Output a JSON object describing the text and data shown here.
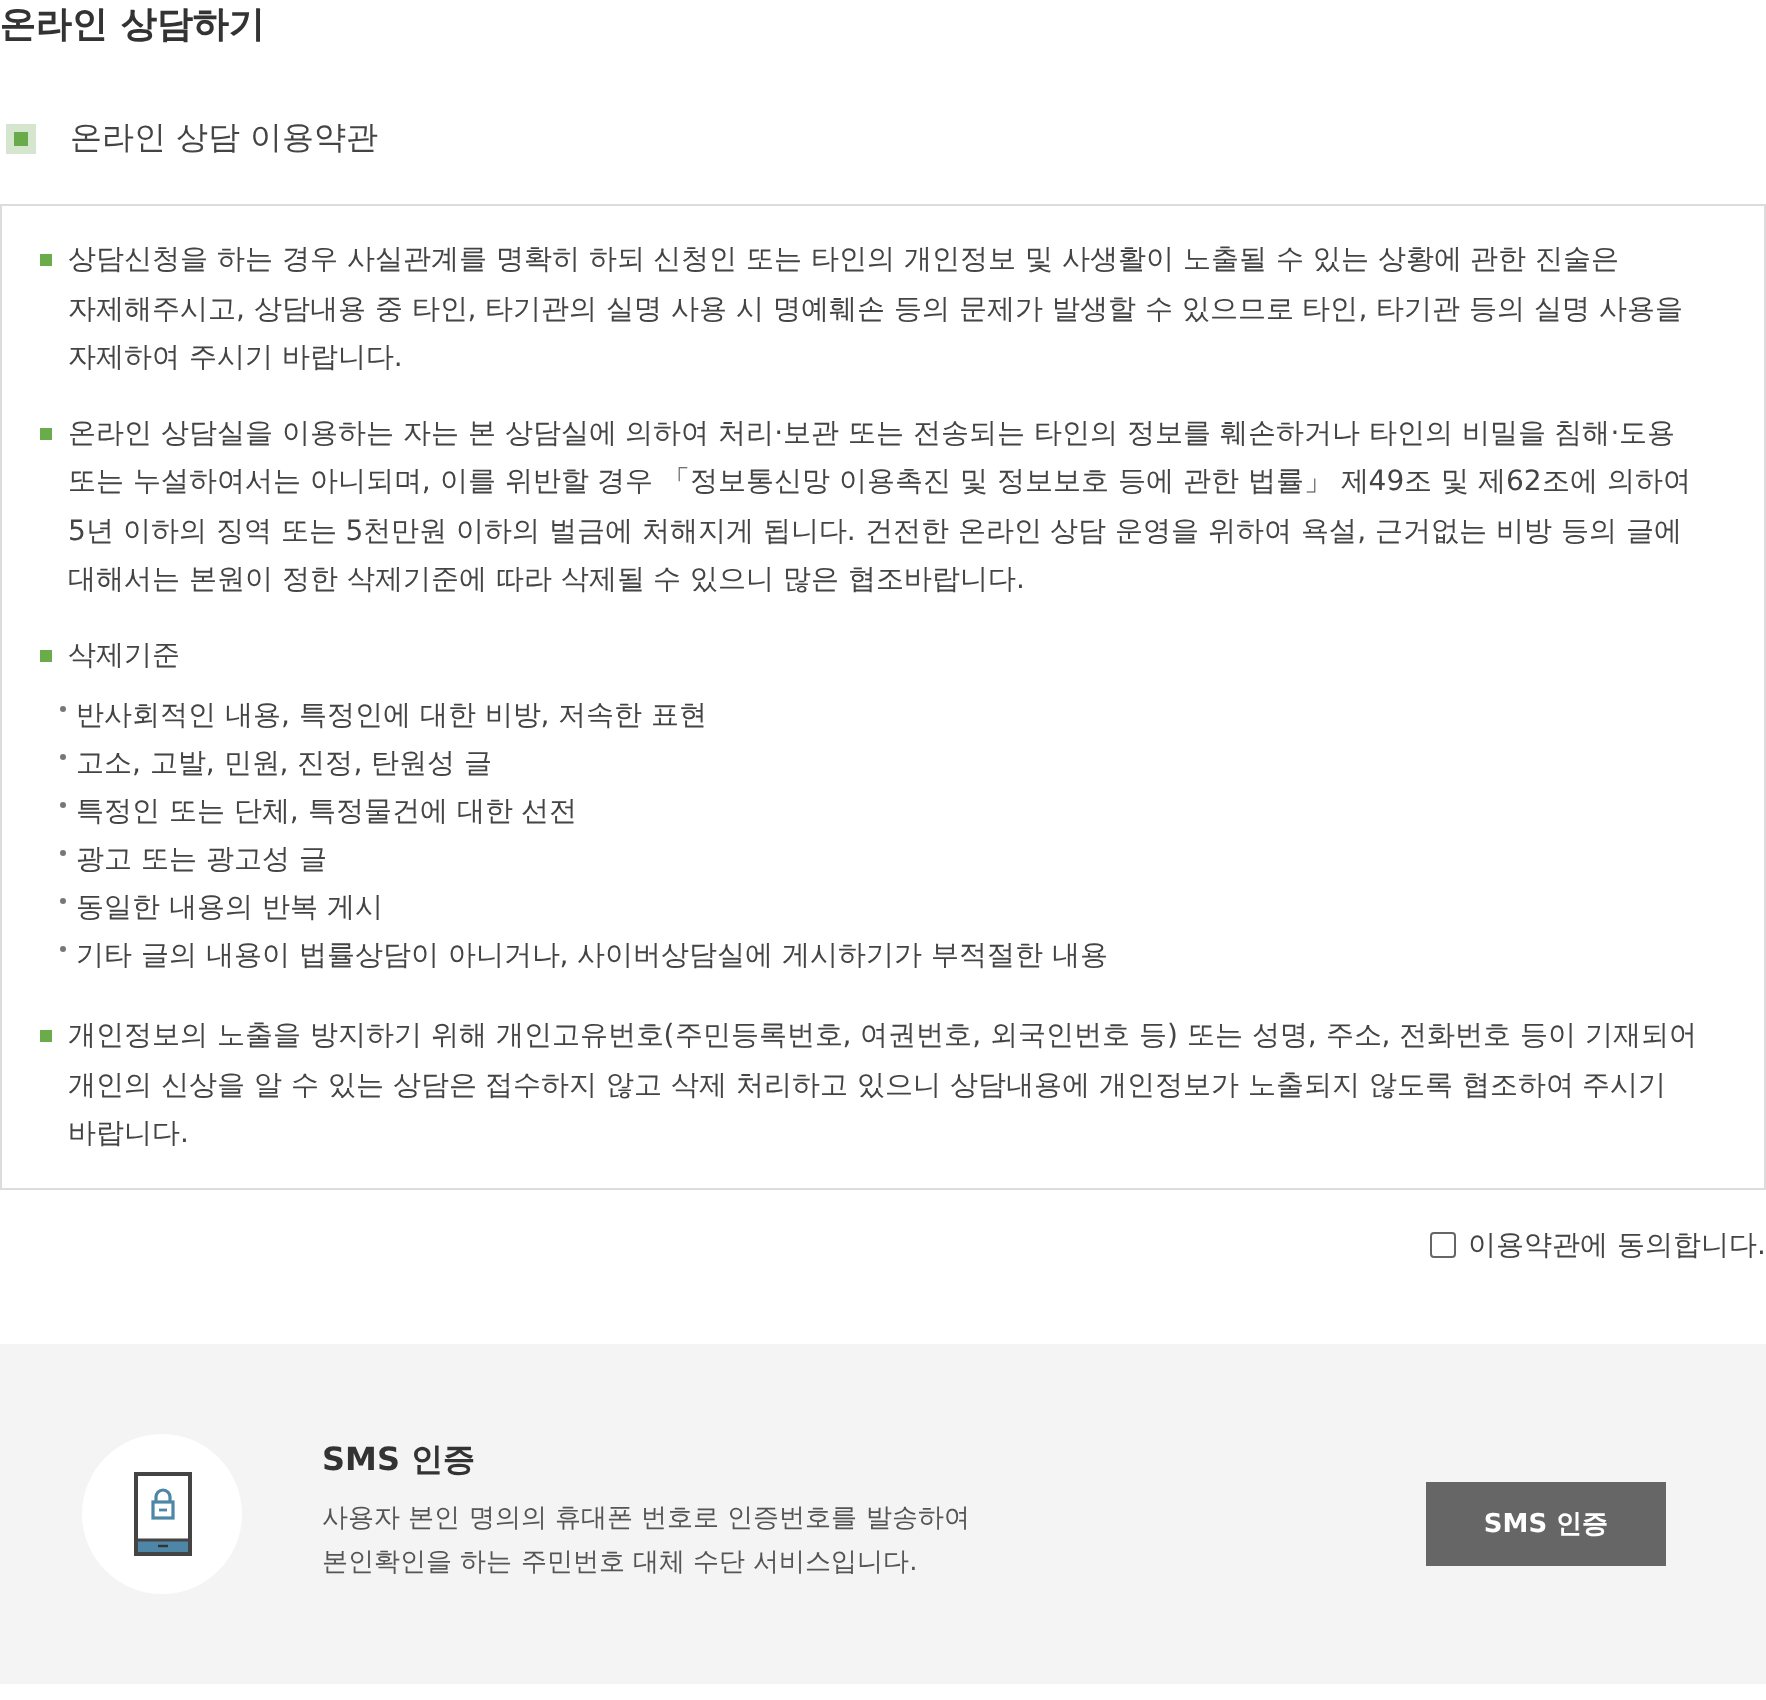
{
  "page": {
    "title": "온라인 상담하기"
  },
  "terms": {
    "heading": "온라인 상담 이용약관",
    "items": [
      {
        "text": "상담신청을 하는 경우 사실관계를 명확히 하되 신청인 또는 타인의 개인정보 및 사생활이 노출될 수 있는 상황에 관한 진술은 자제해주시고, 상담내용 중 타인, 타기관의 실명 사용 시 명예훼손 등의 문제가 발생할 수 있으므로 타인, 타기관 등의 실명 사용을 자제하여 주시기 바랍니다."
      },
      {
        "text": "온라인 상담실을 이용하는 자는 본 상담실에 의하여 처리·보관 또는 전송되는 타인의 정보를 훼손하거나 타인의 비밀을 침해·도용 또는 누설하여서는 아니되며, 이를 위반할 경우 「정보통신망 이용촉진 및 정보보호 등에 관한 법률」 제49조 및 제62조에 의하여 5년 이하의 징역 또는 5천만원 이하의 벌금에 처해지게 됩니다. 건전한 온라인 상담 운영을 위하여 욕설, 근거없는 비방 등의 글에 대해서는 본원이 정한 삭제기준에 따라 삭제될 수 있으니 많은 협조바랍니다."
      },
      {
        "text": "삭제기준",
        "children": [
          {
            "text": "반사회적인 내용, 특정인에 대한 비방, 저속한 표현"
          },
          {
            "text": "고소, 고발, 민원, 진정, 탄원성 글"
          },
          {
            "text": "특정인 또는 단체, 특정물건에 대한 선전"
          },
          {
            "text": "광고 또는 광고성 글"
          },
          {
            "text": "동일한 내용의 반복 게시"
          },
          {
            "text": "기타 글의 내용이 법률상담이 아니거나, 사이버상담실에 게시하기가 부적절한 내용"
          }
        ]
      },
      {
        "text": "개인정보의 노출을 방지하기 위해 개인고유번호(주민등록번호, 여권번호, 외국인번호 등) 또는 성명, 주소, 전화번호 등이 기재되어 개인의 신상을 알 수 있는 상담은 접수하지 않고 삭제 처리하고 있으니 상담내용에 개인정보가 노출되지 않도록 협조하여 주시기 바랍니다."
      }
    ]
  },
  "agreement": {
    "label": "이용약관에 동의합니다.",
    "checked": false
  },
  "sms": {
    "title": "SMS 인증",
    "description": "사용자 본인 명의의 휴대폰 번호로 인증번호를 발송하여 본인확인을 하는 주민번호 대체 수단 서비스입니다.",
    "button": "SMS 인증"
  }
}
